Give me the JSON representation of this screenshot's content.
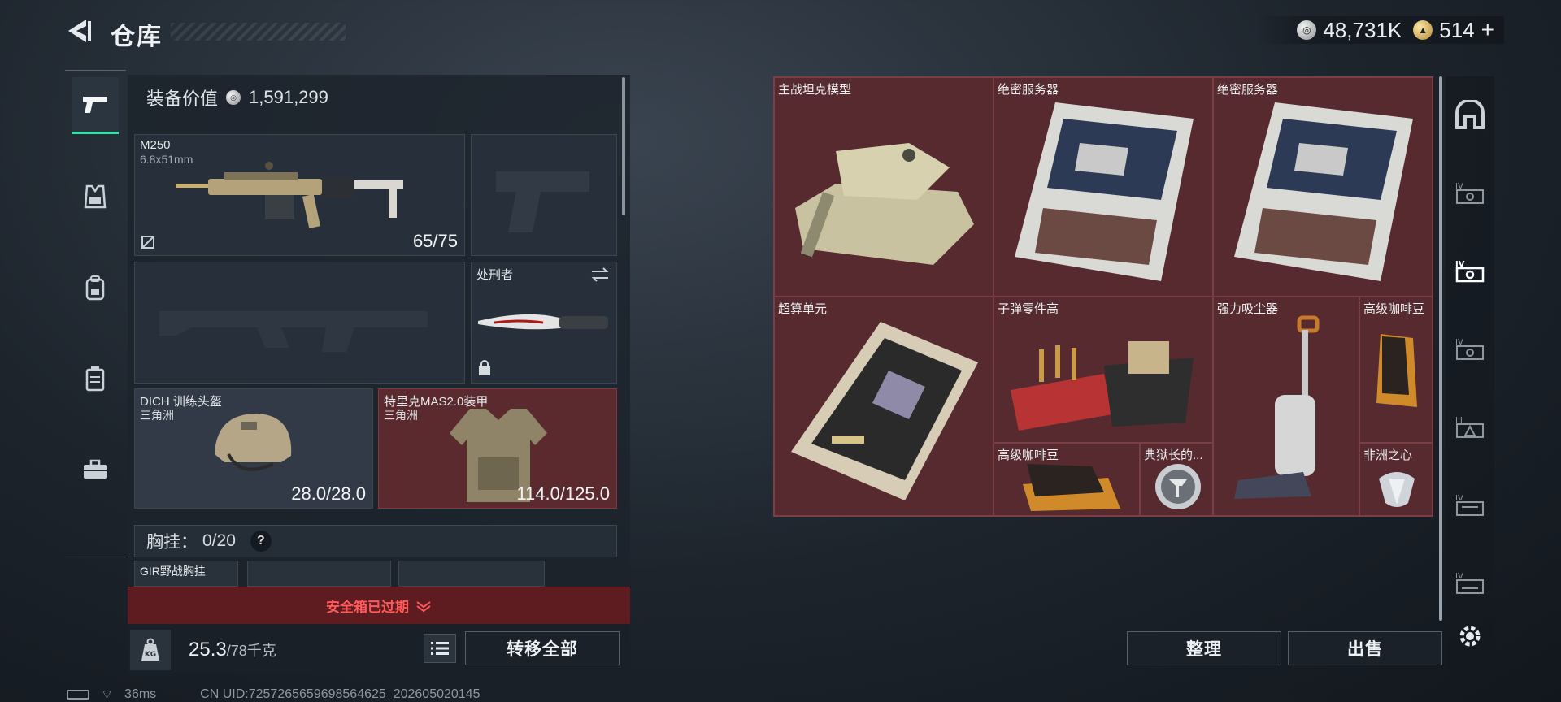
{
  "header": {
    "title": "仓库"
  },
  "currency": {
    "silver": "48,731K",
    "gold": "514",
    "gold_plus": "+"
  },
  "equipment": {
    "value_label": "装备价值",
    "value": "1,591,299",
    "primary": {
      "name": "M250",
      "caliber": "6.8x51mm",
      "ammo": "65/75"
    },
    "melee": {
      "name": "处刑者"
    },
    "helmet": {
      "name": "DICH 训练头盔",
      "map": "三角洲",
      "durability": "28.0/28.0"
    },
    "armor": {
      "name": "特里克MAS2.0装甲",
      "map": "三角洲",
      "durability": "114.0/125.0"
    },
    "chest_rig": {
      "label": "胸挂：",
      "count": "0/20",
      "help": "?"
    },
    "rig_item": {
      "name": "GIR野战胸挂"
    },
    "safebox_text": "安全箱已过期",
    "weight": {
      "current": "25.3",
      "max": "/78千克"
    },
    "transfer_all": "转移全部"
  },
  "storage": {
    "items": [
      {
        "name": "主战坦克模型"
      },
      {
        "name": "绝密服务器"
      },
      {
        "name": "绝密服务器"
      },
      {
        "name": "超算单元"
      },
      {
        "name": "子弹零件高"
      },
      {
        "name": "强力吸尘器"
      },
      {
        "name": "高级咖啡豆"
      },
      {
        "name": "高级咖啡豆"
      },
      {
        "name": "典狱长的..."
      },
      {
        "name": "非洲之心"
      }
    ],
    "sort_button": "整理",
    "sell_button": "出售"
  },
  "status_bar": {
    "ping": "36ms",
    "uid": "CN UID:7257265659698564625_202605020145"
  },
  "colors": {
    "accent": "#2ee3a4",
    "item_bg": "#562a2f",
    "warning": "#ff5a5a"
  }
}
